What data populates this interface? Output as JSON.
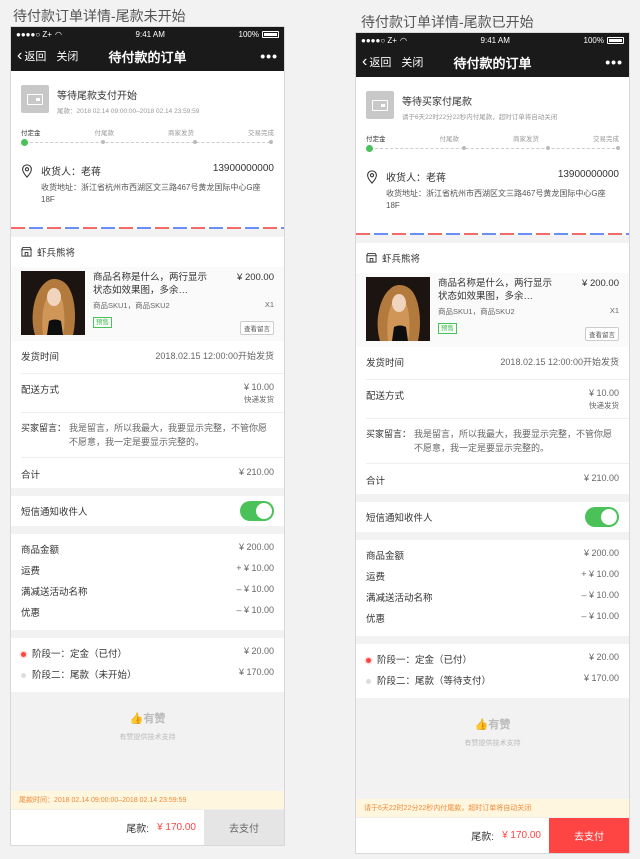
{
  "captions": {
    "left": "待付款订单详情-尾款未开始",
    "right": "待付款订单详情-尾款已开始"
  },
  "statusbar": {
    "carrier": "●●●●○ Z+",
    "time": "9:41 AM",
    "battery": "100%"
  },
  "navbar": {
    "back_label": "返回",
    "close_label": "关闭",
    "title": "待付款的订单",
    "more_label": "•••"
  },
  "left": {
    "status_title": "等待尾款支付开始",
    "status_sub": "尾款：2018 02.14 09:00:00–2018 02.14 23:59:59",
    "notice": "尾款时间：2018 02.14 09:00:00–2018 02.14 23:59:59",
    "phase2_label": "阶段二：尾款（未开始）",
    "pay_label": "去支付"
  },
  "right": {
    "status_title": "等待买家付尾款",
    "status_sub": "请于6天22时22分22秒内付尾款，超时订单将自动关闭",
    "notice": "请于6天22时22分22秒内付尾款，超时订单将自动关闭",
    "phase2_label": "阶段二：尾款（等待支付）",
    "pay_label": "去支付"
  },
  "steps": [
    "付定金",
    "付尾款",
    "商家发货",
    "交易完成"
  ],
  "address": {
    "receiver": "收货人：老蒋",
    "phone": "13900000000",
    "detail": "收货地址：浙江省杭州市西湖区文三路467号黄龙国际中心G座18F"
  },
  "shop": {
    "name": "虾兵熊将"
  },
  "goods": {
    "name": "商品名称是什么，两行显示状态如效果图，多余…",
    "price": "¥ 200.00",
    "sku": "商品SKU1，商品SKU2",
    "qty": "X1",
    "tag": "预售",
    "remark_button": "查看留言"
  },
  "shipping_time": {
    "label": "发货时间",
    "value": "2018.02.15 12:00:00开始发货"
  },
  "delivery": {
    "label": "配送方式",
    "value": "¥ 10.00",
    "sub": "快递发货"
  },
  "buyer_remark": {
    "label": "买家留言：",
    "value": "我是留言，所以我最大，我要显示完整，不管你愿不愿意，我一定是要显示完整的。"
  },
  "subtotal": {
    "label": "合计",
    "value": "¥ 210.00"
  },
  "sms": {
    "label": "短信通知收件人",
    "enabled": true
  },
  "amounts": [
    {
      "label": "商品金额",
      "value": "¥ 200.00"
    },
    {
      "label": "运费",
      "value": "+ ¥ 10.00"
    },
    {
      "label": "满减送活动名称",
      "value": "– ¥ 10.00"
    },
    {
      "label": "优惠",
      "value": "– ¥ 10.00"
    }
  ],
  "phase1": {
    "label": "阶段一：定金（已付）",
    "value": "¥ 20.00"
  },
  "phase2_value": "¥ 170.00",
  "footer": {
    "logo": "有赞",
    "tagline": "有赞提供技术支持"
  },
  "bottom": {
    "total_label": "尾款:",
    "total_value": "¥ 170.00"
  },
  "colors": {
    "accent_red": "#ff4444",
    "green": "#4bc15a",
    "notice_bg": "#fff6e0",
    "notice_text": "#f08a36"
  }
}
